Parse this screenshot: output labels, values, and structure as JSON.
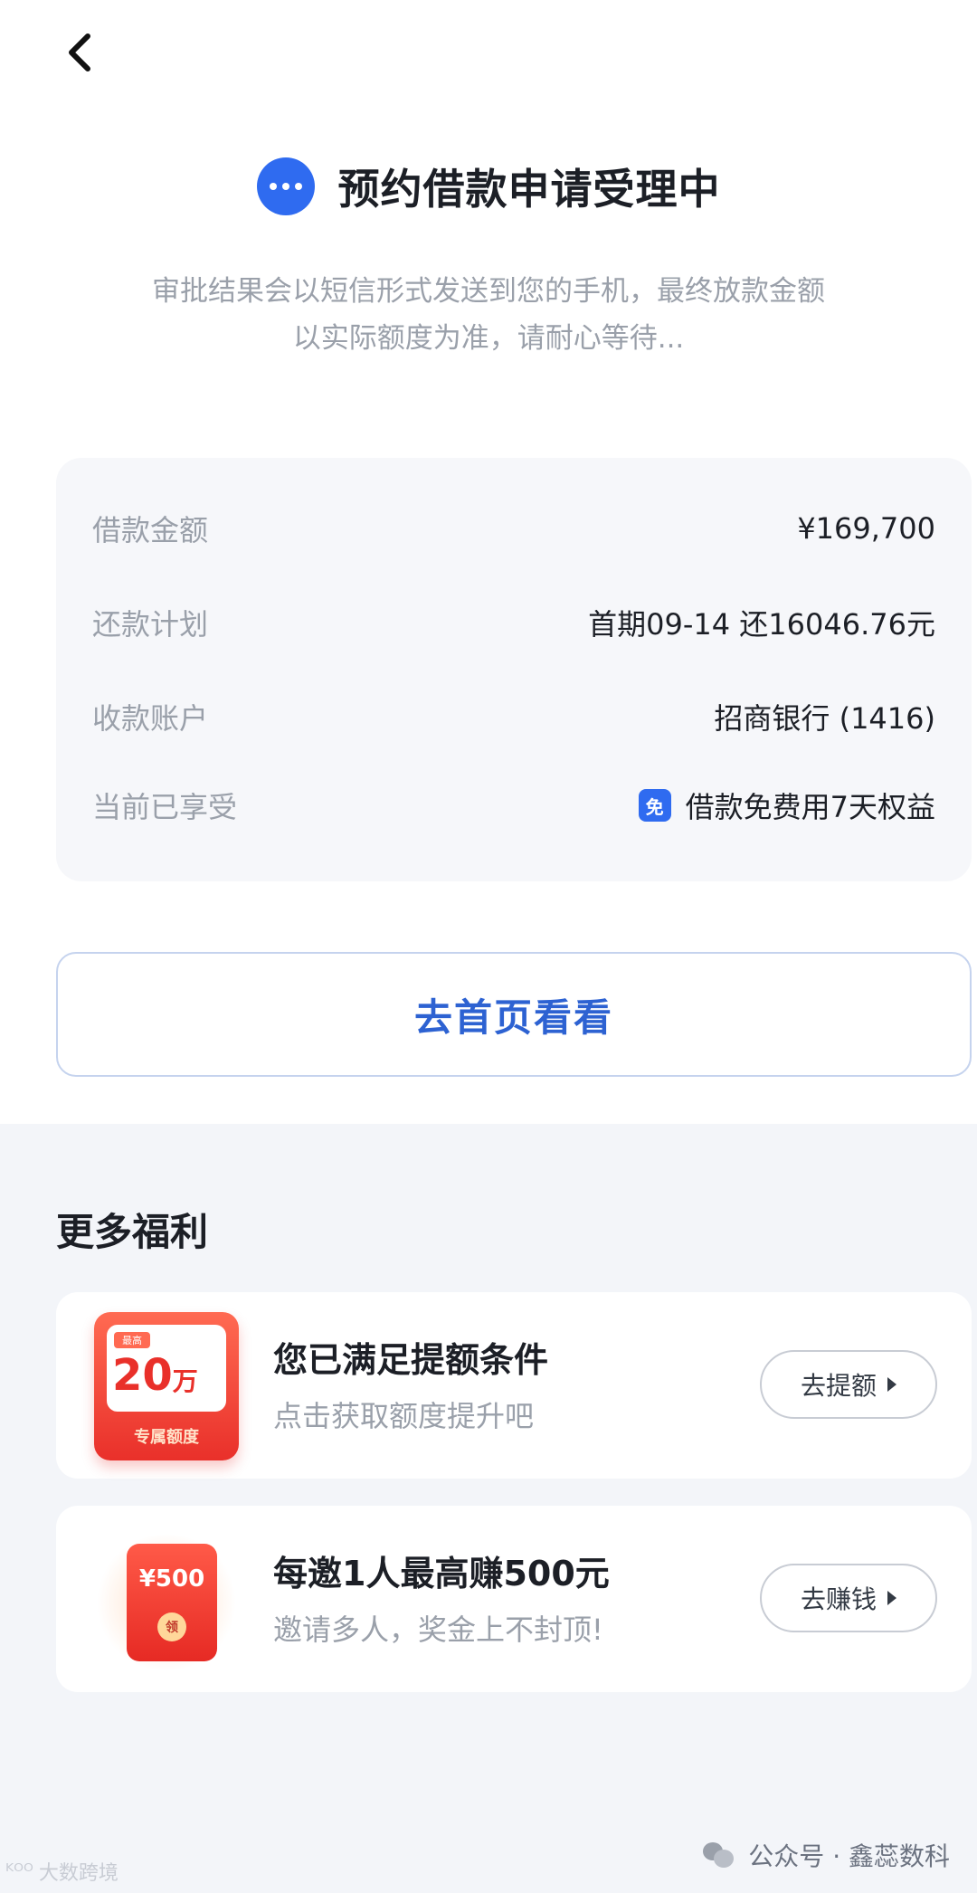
{
  "header": {
    "back_icon": "chevron-left-icon"
  },
  "status": {
    "icon": "more-dots-icon",
    "title": "预约借款申请受理中",
    "accent": "#2f6bf0"
  },
  "notice": {
    "line1": "审批结果会以短信形式发送到您的手机，最终放款金额",
    "line2": "以实际额度为准，请耐心等待..."
  },
  "info": {
    "rows": [
      {
        "label": "借款金额",
        "value": "¥169,700"
      },
      {
        "label": "还款计划",
        "value": "首期09-14 还16046.76元"
      },
      {
        "label": "收款账户",
        "value": "招商银行 (1416)"
      },
      {
        "label": "当前已享受",
        "value": "借款免费用7天权益",
        "icon_text": "免"
      }
    ]
  },
  "home_button": {
    "label": "去首页看看"
  },
  "more": {
    "title": "更多福利",
    "cards": [
      {
        "title": "您已满足提额条件",
        "subtitle": "点击获取额度提升吧",
        "button": "去提额",
        "badge": {
          "tag": "最高",
          "amount": "20",
          "unit": "万",
          "footer": "专属额度"
        }
      },
      {
        "title": "每邀1人最高赚500元",
        "subtitle": "邀请多人，奖金上不封顶!",
        "button": "去赚钱",
        "badge": {
          "amount": "¥500",
          "seal": "领"
        }
      }
    ]
  },
  "watermark": {
    "left": "大数跨境",
    "right": "公众号 · 鑫蕊数科"
  }
}
